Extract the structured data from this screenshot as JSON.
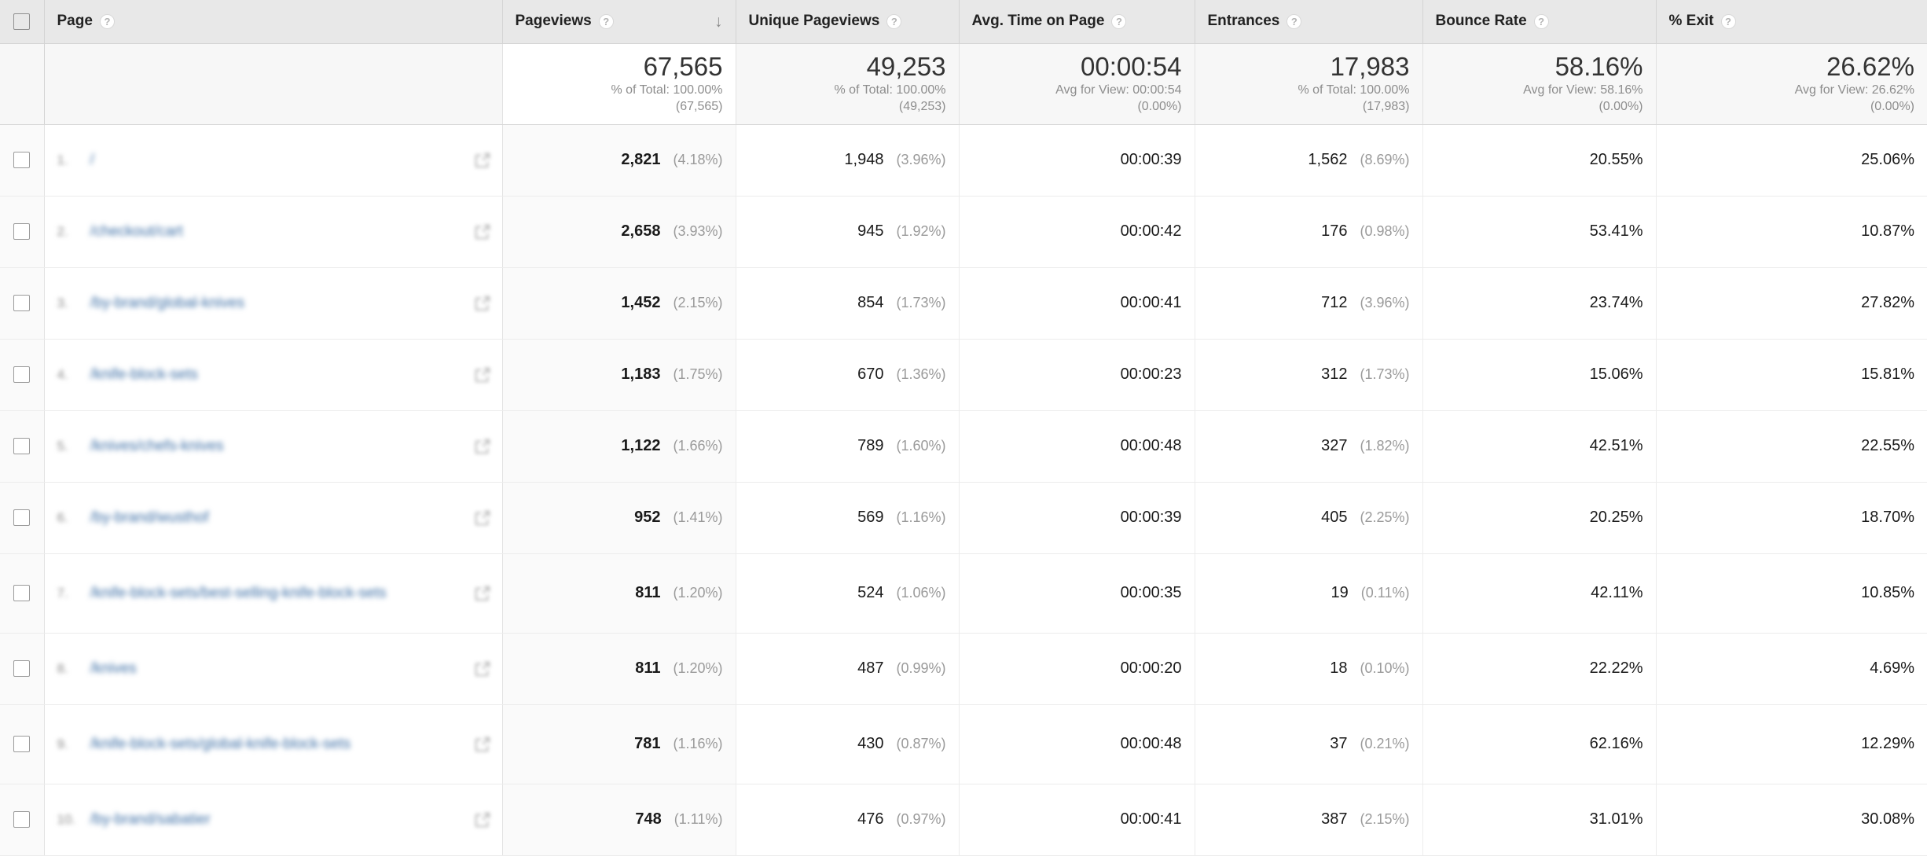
{
  "table": {
    "columns": [
      {
        "key": "page",
        "label": "Page",
        "help": "?",
        "sorted": false,
        "align": "left"
      },
      {
        "key": "pageviews",
        "label": "Pageviews",
        "help": "?",
        "sorted": true,
        "sort_dir": "desc",
        "sort_icon": "arrow-down-icon",
        "align": "right"
      },
      {
        "key": "unique_pageviews",
        "label": "Unique Pageviews",
        "help": "?",
        "sorted": false,
        "align": "right"
      },
      {
        "key": "avg_time",
        "label": "Avg. Time on Page",
        "help": "?",
        "sorted": false,
        "align": "right"
      },
      {
        "key": "entrances",
        "label": "Entrances",
        "help": "?",
        "sorted": false,
        "align": "right"
      },
      {
        "key": "bounce_rate",
        "label": "Bounce Rate",
        "help": "?",
        "sorted": false,
        "align": "right"
      },
      {
        "key": "exit_rate",
        "label": "% Exit",
        "help": "?",
        "sorted": false,
        "align": "right"
      }
    ],
    "select_all_checkbox": {
      "checked": false
    },
    "summary": {
      "pageviews": {
        "value": "67,565",
        "sub1": "% of Total: 100.00%",
        "sub2": "(67,565)"
      },
      "unique_pageviews": {
        "value": "49,253",
        "sub1": "% of Total: 100.00%",
        "sub2": "(49,253)"
      },
      "avg_time": {
        "value": "00:00:54",
        "sub1": "Avg for View: 00:00:54",
        "sub2": "(0.00%)"
      },
      "entrances": {
        "value": "17,983",
        "sub1": "% of Total: 100.00%",
        "sub2": "(17,983)"
      },
      "bounce_rate": {
        "value": "58.16%",
        "sub1": "Avg for View: 58.16%",
        "sub2": "(0.00%)"
      },
      "exit_rate": {
        "value": "26.62%",
        "sub1": "Avg for View: 26.62%",
        "sub2": "(0.00%)"
      }
    },
    "rows": [
      {
        "index": "1.",
        "page": "/",
        "page_redacted": true,
        "two_line": false,
        "pageviews": "2,821",
        "pageviews_pct": "(4.18%)",
        "unique_pageviews": "1,948",
        "unique_pageviews_pct": "(3.96%)",
        "avg_time": "00:00:39",
        "entrances": "1,562",
        "entrances_pct": "(8.69%)",
        "bounce_rate": "20.55%",
        "exit_rate": "25.06%"
      },
      {
        "index": "2.",
        "page": "/checkout/cart",
        "page_redacted": true,
        "two_line": false,
        "pageviews": "2,658",
        "pageviews_pct": "(3.93%)",
        "unique_pageviews": "945",
        "unique_pageviews_pct": "(1.92%)",
        "avg_time": "00:00:42",
        "entrances": "176",
        "entrances_pct": "(0.98%)",
        "bounce_rate": "53.41%",
        "exit_rate": "10.87%"
      },
      {
        "index": "3.",
        "page": "/by-brand/global-knives",
        "page_redacted": true,
        "two_line": false,
        "pageviews": "1,452",
        "pageviews_pct": "(2.15%)",
        "unique_pageviews": "854",
        "unique_pageviews_pct": "(1.73%)",
        "avg_time": "00:00:41",
        "entrances": "712",
        "entrances_pct": "(3.96%)",
        "bounce_rate": "23.74%",
        "exit_rate": "27.82%"
      },
      {
        "index": "4.",
        "page": "/knife-block-sets",
        "page_redacted": true,
        "two_line": false,
        "pageviews": "1,183",
        "pageviews_pct": "(1.75%)",
        "unique_pageviews": "670",
        "unique_pageviews_pct": "(1.36%)",
        "avg_time": "00:00:23",
        "entrances": "312",
        "entrances_pct": "(1.73%)",
        "bounce_rate": "15.06%",
        "exit_rate": "15.81%"
      },
      {
        "index": "5.",
        "page": "/knives/chefs-knives",
        "page_redacted": true,
        "two_line": false,
        "pageviews": "1,122",
        "pageviews_pct": "(1.66%)",
        "unique_pageviews": "789",
        "unique_pageviews_pct": "(1.60%)",
        "avg_time": "00:00:48",
        "entrances": "327",
        "entrances_pct": "(1.82%)",
        "bounce_rate": "42.51%",
        "exit_rate": "22.55%"
      },
      {
        "index": "6.",
        "page": "/by-brand/wusthof",
        "page_redacted": true,
        "two_line": false,
        "pageviews": "952",
        "pageviews_pct": "(1.41%)",
        "unique_pageviews": "569",
        "unique_pageviews_pct": "(1.16%)",
        "avg_time": "00:00:39",
        "entrances": "405",
        "entrances_pct": "(2.25%)",
        "bounce_rate": "20.25%",
        "exit_rate": "18.70%"
      },
      {
        "index": "7.",
        "page": "/knife-block-sets/best-selling-knife-block-sets",
        "page_redacted": true,
        "two_line": true,
        "pageviews": "811",
        "pageviews_pct": "(1.20%)",
        "unique_pageviews": "524",
        "unique_pageviews_pct": "(1.06%)",
        "avg_time": "00:00:35",
        "entrances": "19",
        "entrances_pct": "(0.11%)",
        "bounce_rate": "42.11%",
        "exit_rate": "10.85%"
      },
      {
        "index": "8.",
        "page": "/knives",
        "page_redacted": true,
        "two_line": false,
        "pageviews": "811",
        "pageviews_pct": "(1.20%)",
        "unique_pageviews": "487",
        "unique_pageviews_pct": "(0.99%)",
        "avg_time": "00:00:20",
        "entrances": "18",
        "entrances_pct": "(0.10%)",
        "bounce_rate": "22.22%",
        "exit_rate": "4.69%"
      },
      {
        "index": "9.",
        "page": "/knife-block-sets/global-knife-block-sets",
        "page_redacted": true,
        "two_line": true,
        "pageviews": "781",
        "pageviews_pct": "(1.16%)",
        "unique_pageviews": "430",
        "unique_pageviews_pct": "(0.87%)",
        "avg_time": "00:00:48",
        "entrances": "37",
        "entrances_pct": "(0.21%)",
        "bounce_rate": "62.16%",
        "exit_rate": "12.29%"
      },
      {
        "index": "10.",
        "page": "/by-brand/sabatier",
        "page_redacted": true,
        "two_line": false,
        "pageviews": "748",
        "pageviews_pct": "(1.11%)",
        "unique_pageviews": "476",
        "unique_pageviews_pct": "(0.97%)",
        "avg_time": "00:00:41",
        "entrances": "387",
        "entrances_pct": "(2.15%)",
        "bounce_rate": "31.01%",
        "exit_rate": "30.08%"
      }
    ]
  },
  "colors": {
    "header_bg": "#e8e8e8",
    "sorted_col_bg": "#fafafa",
    "link": "#3c6ea5",
    "muted_text": "#9a9a9a"
  }
}
